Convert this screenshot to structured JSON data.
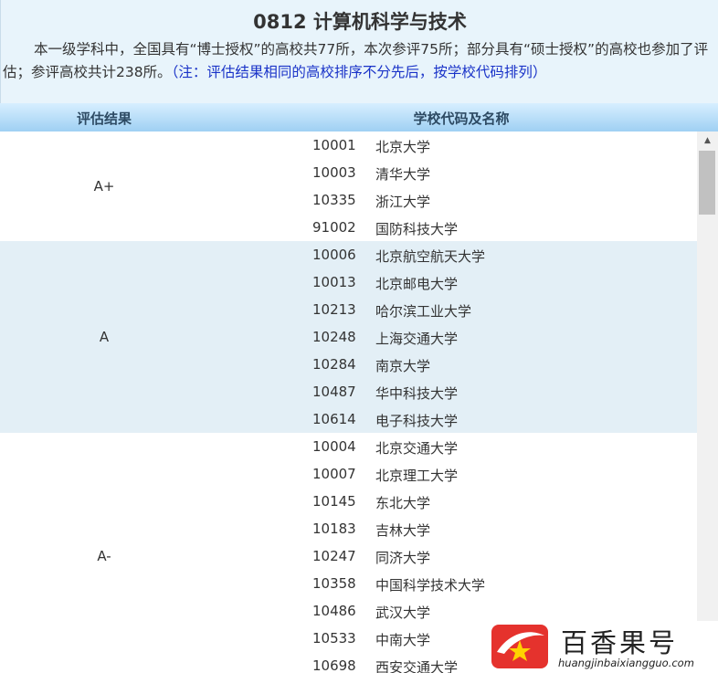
{
  "header": {
    "title": "0812 计算机科学与技术",
    "intro": "本一级学科中，全国具有“博士授权”的高校共77所，本次参评75所；部分具有“硕士授权”的高校也参加了评估；参评高校共计238所。",
    "note": "（注：评估结果相同的高校排序不分先后，按学校代码排列）"
  },
  "table": {
    "col_grade": "评估结果",
    "col_school": "学校代码及名称",
    "groups": [
      {
        "grade": "A+",
        "rows": [
          {
            "code": "10001",
            "name": "北京大学"
          },
          {
            "code": "10003",
            "name": "清华大学"
          },
          {
            "code": "10335",
            "name": "浙江大学"
          },
          {
            "code": "91002",
            "name": "国防科技大学"
          }
        ]
      },
      {
        "grade": "A",
        "rows": [
          {
            "code": "10006",
            "name": "北京航空航天大学"
          },
          {
            "code": "10013",
            "name": "北京邮电大学"
          },
          {
            "code": "10213",
            "name": "哈尔滨工业大学"
          },
          {
            "code": "10248",
            "name": "上海交通大学"
          },
          {
            "code": "10284",
            "name": "南京大学"
          },
          {
            "code": "10487",
            "name": "华中科技大学"
          },
          {
            "code": "10614",
            "name": "电子科技大学"
          }
        ]
      },
      {
        "grade": "A-",
        "rows": [
          {
            "code": "10004",
            "name": "北京交通大学"
          },
          {
            "code": "10007",
            "name": "北京理工大学"
          },
          {
            "code": "10145",
            "name": "东北大学"
          },
          {
            "code": "10183",
            "name": "吉林大学"
          },
          {
            "code": "10247",
            "name": "同济大学"
          },
          {
            "code": "10358",
            "name": "中国科学技术大学"
          },
          {
            "code": "10486",
            "name": "武汉大学"
          },
          {
            "code": "10533",
            "name": "中南大学"
          },
          {
            "code": "10698",
            "name": "西安交通大学"
          }
        ]
      }
    ]
  },
  "scrollbar": {
    "up_icon": "▲"
  },
  "watermark": {
    "brand": "百香果号",
    "url": "huangjinbaixiangguo.com",
    "logo_icon": "star-logo-icon",
    "logo_colors": {
      "red": "#e5322d",
      "yellow": "#ffd200"
    }
  }
}
